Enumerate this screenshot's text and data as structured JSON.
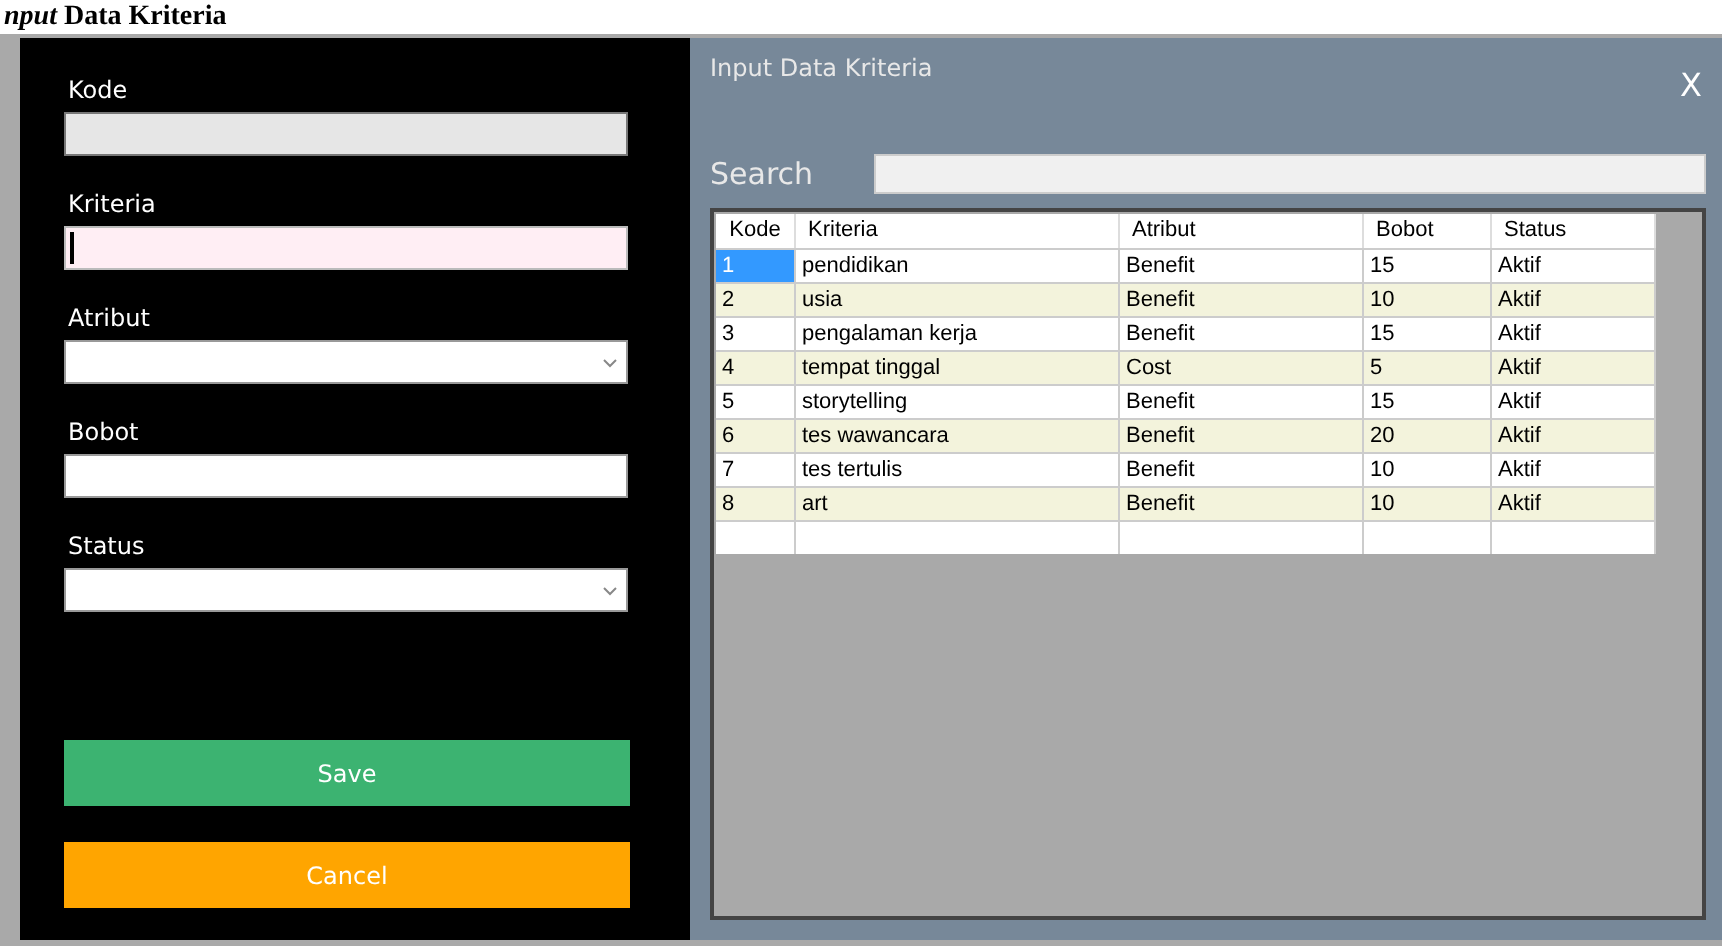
{
  "caption": "*nput* Data Kriteria",
  "form": {
    "fields": [
      {
        "label": "Kode",
        "kind": "text",
        "disabled": true,
        "focused": false
      },
      {
        "label": "Kriteria",
        "kind": "text",
        "disabled": false,
        "focused": true
      },
      {
        "label": "Atribut",
        "kind": "select",
        "disabled": false,
        "focused": false
      },
      {
        "label": "Bobot",
        "kind": "text",
        "disabled": false,
        "focused": false
      },
      {
        "label": "Status",
        "kind": "select",
        "disabled": false,
        "focused": false
      }
    ],
    "buttons": [
      {
        "label": "Save",
        "kind": "save"
      },
      {
        "label": "Cancel",
        "kind": "cancel"
      }
    ]
  },
  "window": {
    "title": "Input Data Kriteria",
    "close": "X"
  },
  "search": {
    "label": "Search"
  },
  "table": {
    "columns": [
      "Kode",
      "Kriteria",
      "Atribut",
      "Bobot",
      "Status"
    ],
    "rows": [
      {
        "cells": [
          "1",
          "pendidikan",
          "Benefit",
          "15",
          "Aktif"
        ],
        "selected": true
      },
      {
        "cells": [
          "2",
          "usia",
          "Benefit",
          "10",
          "Aktif"
        ],
        "selected": false
      },
      {
        "cells": [
          "3",
          "pengalaman kerja",
          "Benefit",
          "15",
          "Aktif"
        ],
        "selected": false
      },
      {
        "cells": [
          "4",
          "tempat tinggal",
          "Cost",
          "5",
          "Aktif"
        ],
        "selected": false
      },
      {
        "cells": [
          "5",
          "storytelling",
          "Benefit",
          "15",
          "Aktif"
        ],
        "selected": false
      },
      {
        "cells": [
          "6",
          "tes wawancara",
          "Benefit",
          "20",
          "Aktif"
        ],
        "selected": false
      },
      {
        "cells": [
          "7",
          "tes tertulis",
          "Benefit",
          "10",
          "Aktif"
        ],
        "selected": false
      },
      {
        "cells": [
          "8",
          "art",
          "Benefit",
          "10",
          "Aktif"
        ],
        "selected": false
      }
    ]
  }
}
